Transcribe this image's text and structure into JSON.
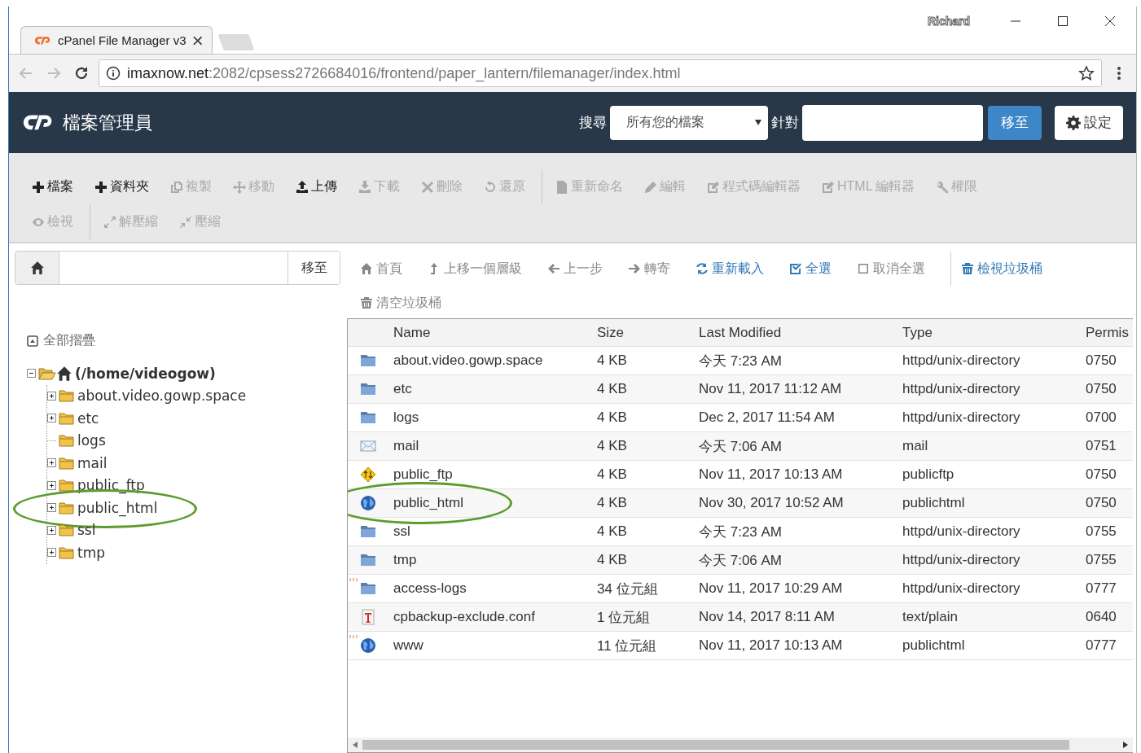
{
  "browser": {
    "tab_title": "cPanel File Manager v3",
    "profile": "Richard",
    "url_host": "imaxnow.net",
    "url_rest": ":2082/cpsess2726684016/frontend/paper_lantern/filemanager/index.html"
  },
  "header": {
    "title": "檔案管理員",
    "search_label": "搜尋",
    "search_scope": "所有您的檔案",
    "for_label": "針對",
    "go_button": "移至",
    "settings_button": "設定"
  },
  "toolbar": {
    "lines": [
      {
        "groups": [
          {
            "items": [
              {
                "label": "檔案",
                "kind": "plus",
                "disabled": false
              },
              {
                "label": "資料夾",
                "kind": "plus",
                "disabled": false
              },
              {
                "label": "複製",
                "kind": "copy",
                "disabled": true
              },
              {
                "label": "移動",
                "kind": "move",
                "disabled": true
              },
              {
                "label": "上傳",
                "kind": "upload",
                "disabled": false
              },
              {
                "label": "下載",
                "kind": "download",
                "disabled": true
              },
              {
                "label": "刪除",
                "kind": "times",
                "disabled": true
              },
              {
                "label": "還原",
                "kind": "undo",
                "disabled": true
              }
            ]
          },
          {
            "items": [
              {
                "label": "重新命名",
                "kind": "file",
                "disabled": true
              },
              {
                "label": "編輯",
                "kind": "pencil",
                "disabled": true
              },
              {
                "label": "程式碼編輯器",
                "kind": "edit",
                "disabled": true
              },
              {
                "label": "HTML 編輯器",
                "kind": "edit",
                "disabled": true
              },
              {
                "label": "權限",
                "kind": "key",
                "disabled": true
              }
            ]
          }
        ]
      },
      {
        "groups": [
          {
            "items": [
              {
                "label": "檢視",
                "kind": "eye",
                "disabled": true
              }
            ]
          },
          {
            "items": [
              {
                "label": "解壓縮",
                "kind": "expand",
                "disabled": true
              },
              {
                "label": "壓縮",
                "kind": "compress",
                "disabled": true
              }
            ]
          }
        ]
      }
    ]
  },
  "path_bar": {
    "go_button": "移至"
  },
  "nav": {
    "lines": [
      {
        "groups": [
          {
            "items": [
              {
                "label": "首頁",
                "kind": "home",
                "disabled": true
              },
              {
                "label": "上移一個層級",
                "kind": "levelup",
                "disabled": true
              },
              {
                "label": "上一步",
                "kind": "left",
                "disabled": true
              },
              {
                "label": "轉寄",
                "kind": "right",
                "disabled": true
              },
              {
                "label": "重新載入",
                "kind": "refresh",
                "disabled": false
              },
              {
                "label": "全選",
                "kind": "checksq",
                "disabled": false
              },
              {
                "label": "取消全選",
                "kind": "square",
                "disabled": true
              }
            ]
          },
          {
            "items": [
              {
                "label": "檢視垃圾桶",
                "kind": "trash",
                "disabled": false
              }
            ]
          }
        ]
      },
      {
        "groups": [
          {
            "items": [
              {
                "label": "清空垃圾桶",
                "kind": "trash",
                "disabled": true
              }
            ]
          }
        ]
      }
    ]
  },
  "tree": {
    "collapse_all": "全部摺疊",
    "root": {
      "label": "(/home/videogow)",
      "expanded": true,
      "children": [
        {
          "label": "about.video.gowp.space",
          "expandable": true,
          "circled": false
        },
        {
          "label": "etc",
          "expandable": true,
          "circled": false
        },
        {
          "label": "logs",
          "expandable": false,
          "circled": false
        },
        {
          "label": "mail",
          "expandable": true,
          "circled": false
        },
        {
          "label": "public_ftp",
          "expandable": true,
          "circled": false
        },
        {
          "label": "public_html",
          "expandable": true,
          "circled": true
        },
        {
          "label": "ssl",
          "expandable": true,
          "circled": false
        },
        {
          "label": "tmp",
          "expandable": true,
          "circled": false
        }
      ]
    }
  },
  "table": {
    "columns": [
      "Name",
      "Size",
      "Last Modified",
      "Type",
      "Permis"
    ],
    "rows": [
      {
        "kind": "folder",
        "symlink": false,
        "circled": false,
        "name": "about.video.gowp.space",
        "size": "4 KB",
        "modified": "今天 7:23 AM",
        "type": "httpd/unix-directory",
        "perms": "0750"
      },
      {
        "kind": "folder",
        "symlink": false,
        "circled": false,
        "name": "etc",
        "size": "4 KB",
        "modified": "Nov 11, 2017 11:12 AM",
        "type": "httpd/unix-directory",
        "perms": "0750"
      },
      {
        "kind": "folder",
        "symlink": false,
        "circled": false,
        "name": "logs",
        "size": "4 KB",
        "modified": "Dec 2, 2017 11:54 AM",
        "type": "httpd/unix-directory",
        "perms": "0700"
      },
      {
        "kind": "mail",
        "symlink": false,
        "circled": false,
        "name": "mail",
        "size": "4 KB",
        "modified": "今天 7:06 AM",
        "type": "mail",
        "perms": "0751"
      },
      {
        "kind": "ftp",
        "symlink": false,
        "circled": false,
        "name": "public_ftp",
        "size": "4 KB",
        "modified": "Nov 11, 2017 10:13 AM",
        "type": "publicftp",
        "perms": "0750"
      },
      {
        "kind": "globe",
        "symlink": false,
        "circled": true,
        "name": "public_html",
        "size": "4 KB",
        "modified": "Nov 30, 2017 10:52 AM",
        "type": "publichtml",
        "perms": "0750"
      },
      {
        "kind": "folder",
        "symlink": false,
        "circled": false,
        "name": "ssl",
        "size": "4 KB",
        "modified": "今天 7:23 AM",
        "type": "httpd/unix-directory",
        "perms": "0755"
      },
      {
        "kind": "folder",
        "symlink": false,
        "circled": false,
        "name": "tmp",
        "size": "4 KB",
        "modified": "今天 7:06 AM",
        "type": "httpd/unix-directory",
        "perms": "0755"
      },
      {
        "kind": "folder",
        "symlink": true,
        "circled": false,
        "name": "access-logs",
        "size": "34 位元組",
        "modified": "Nov 11, 2017 10:29 AM",
        "type": "httpd/unix-directory",
        "perms": "0777"
      },
      {
        "kind": "text",
        "symlink": false,
        "circled": false,
        "name": "cpbackup-exclude.conf",
        "size": "1 位元組",
        "modified": "Nov 14, 2017 8:11 AM",
        "type": "text/plain",
        "perms": "0640"
      },
      {
        "kind": "globe",
        "symlink": true,
        "circled": false,
        "name": "www",
        "size": "11 位元組",
        "modified": "Nov 11, 2017 10:13 AM",
        "type": "publichtml",
        "perms": "0777"
      }
    ]
  }
}
